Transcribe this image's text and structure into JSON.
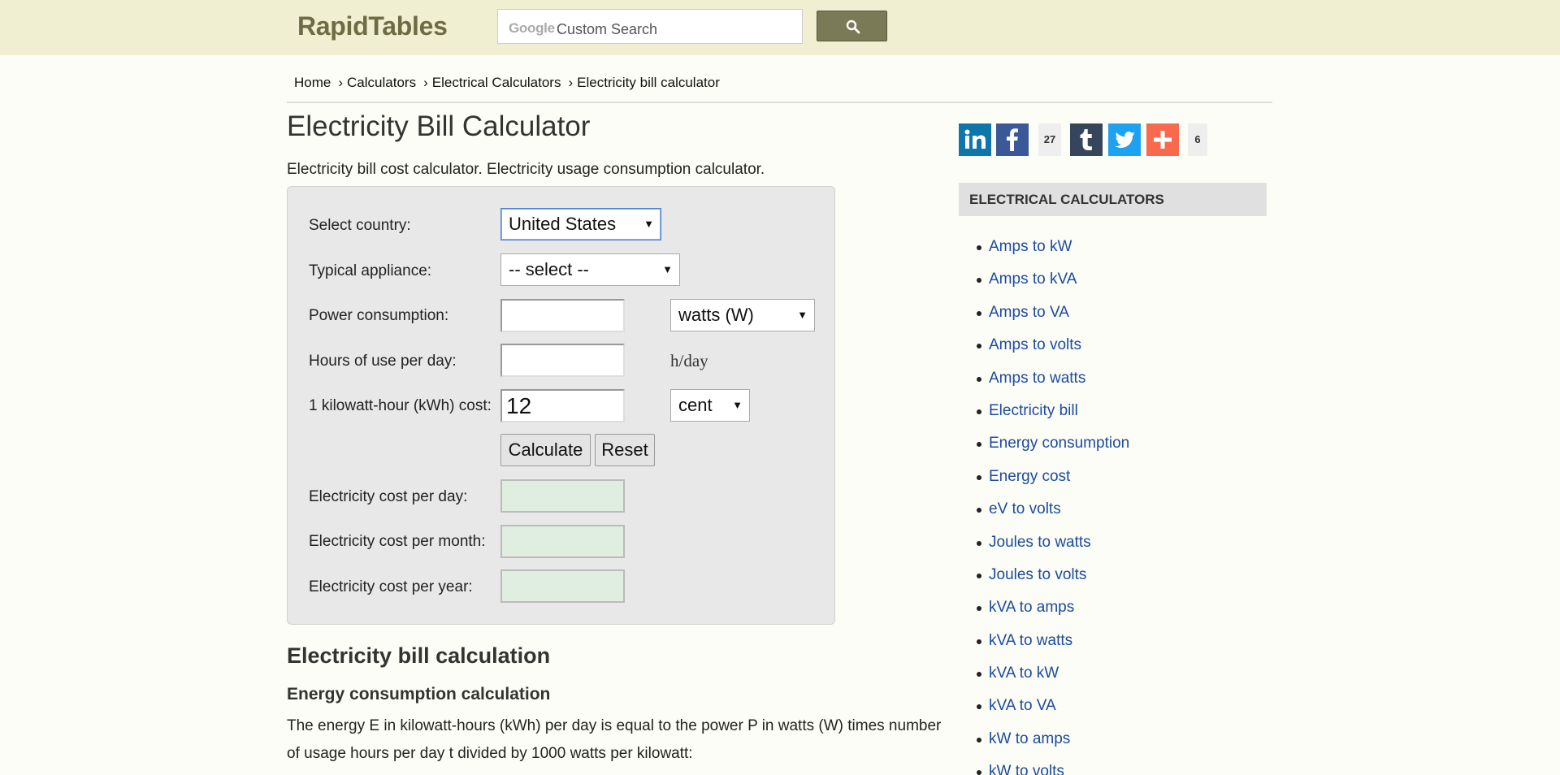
{
  "header": {
    "logo": "RapidTables",
    "search_brand": "Google",
    "search_placeholder": "Custom Search"
  },
  "breadcrumb": [
    "Home",
    "Calculators",
    "Electrical Calculators",
    "Electricity bill calculator"
  ],
  "breadcrumb_sep": "›",
  "page": {
    "title": "Electricity Bill Calculator",
    "description": "Electricity bill cost calculator. Electricity usage consumption calculator."
  },
  "form": {
    "country_label": "Select country:",
    "country_value": "United States",
    "appliance_label": "Typical appliance:",
    "appliance_value": "-- select --",
    "power_label": "Power consumption:",
    "power_value": "",
    "power_unit": "watts (W)",
    "hours_label": "Hours of use per day:",
    "hours_value": "",
    "hours_unit": "h/day",
    "kwh_label": "1 kilowatt-hour (kWh) cost:",
    "kwh_value": "12",
    "kwh_unit": "cent",
    "calculate": "Calculate",
    "reset": "Reset",
    "cost_day_label": "Electricity cost per day:",
    "cost_month_label": "Electricity cost per month:",
    "cost_year_label": "Electricity cost per year:"
  },
  "content": {
    "section_title": "Electricity bill calculation",
    "sub_title": "Energy consumption calculation",
    "paragraph": "The energy E in kilowatt-hours (kWh) per day is equal to the power P in watts (W) times number of usage hours per day t divided by 1000 watts per kilowatt:"
  },
  "share": {
    "facebook_count": "27",
    "addthis_count": "6",
    "colors": {
      "linkedin": "#0e76a8",
      "facebook": "#3b5998",
      "tumblr": "#35465c",
      "twitter": "#1da1f2",
      "addthis": "#f8694d"
    }
  },
  "sidebar": {
    "header": "ELECTRICAL CALCULATORS",
    "items": [
      "Amps to kW",
      "Amps to kVA",
      "Amps to VA",
      "Amps to volts",
      "Amps to watts",
      "Electricity bill",
      "Energy consumption",
      "Energy cost",
      "eV to volts",
      "Joules to watts",
      "Joules to volts",
      "kVA to amps",
      "kVA to watts",
      "kVA to kW",
      "kVA to VA",
      "kW to amps",
      "kW to volts"
    ]
  }
}
